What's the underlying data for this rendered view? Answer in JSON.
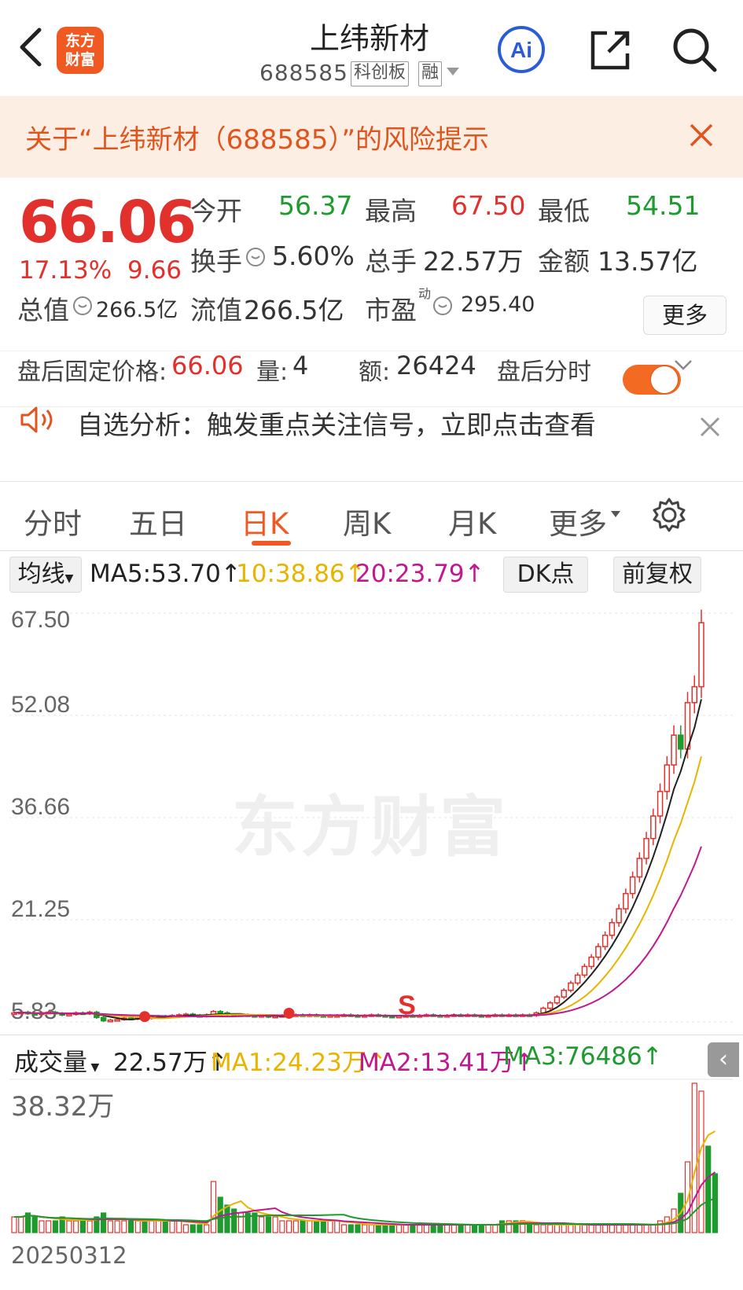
{
  "header": {
    "logo_line1": "东方",
    "logo_line2": "财富",
    "stock_name": "上纬新材",
    "stock_code": "688585",
    "board_tag": "科创板",
    "margin_tag": "融",
    "ai_label": "Ai"
  },
  "risk_banner": {
    "text": "关于“上纬新材（688585）”的风险提示"
  },
  "quote": {
    "price": "66.06",
    "change_pct": "17.13%",
    "change": "9.66",
    "fields": [
      {
        "label": "今开",
        "value": "56.37",
        "color": "#1e9b2f"
      },
      {
        "label": "最高",
        "value": "67.50",
        "color": "#e2312d"
      },
      {
        "label": "最低",
        "value": "54.51",
        "color": "#1e9b2f"
      },
      {
        "label": "换手",
        "value": "5.60%",
        "color": "#333333"
      },
      {
        "label": "总手",
        "value": "22.57万",
        "color": "#333333"
      },
      {
        "label": "金额",
        "value": "13.57亿",
        "color": "#333333"
      },
      {
        "label": "总值",
        "value": "266.5亿",
        "color": "#333333"
      },
      {
        "label": "流值",
        "value": "266.5亿",
        "color": "#333333"
      },
      {
        "label": "市盈",
        "value": "295.40",
        "color": "#333333"
      }
    ],
    "pe_superscript": "动",
    "more_button": "更多"
  },
  "after_hours": {
    "price_label": "盘后固定价格:",
    "price": "66.06",
    "volume_label": "量:",
    "volume": "4",
    "amount_label": "额:",
    "amount": "26424",
    "toggle_label": "盘后分时",
    "toggle_on": true
  },
  "analysis": {
    "text": "自选分析：触发重点关注信号，立即点击查看"
  },
  "tabs": [
    {
      "label": "分时",
      "active": false
    },
    {
      "label": "五日",
      "active": false
    },
    {
      "label": "日K",
      "active": true
    },
    {
      "label": "周K",
      "active": false
    },
    {
      "label": "月K",
      "active": false
    },
    {
      "label": "更多",
      "active": false
    }
  ],
  "ma_bar": {
    "selector": "均线",
    "ma5": "MA5:53.70↑",
    "ma10": "10:38.86↑",
    "ma20": "20:23.79↑",
    "dk_button": "DK点",
    "adjust_button": "前复权",
    "colors": {
      "ma5": "#222222",
      "ma10": "#e8b400",
      "ma20": "#c2188f"
    }
  },
  "watermark": "东方财富",
  "volume_bar": {
    "selector": "成交量",
    "vol": "22.57万↑",
    "ma1": "MA1:24.23万↑",
    "ma2": "MA2:13.41万↑",
    "ma3": "MA3:76486↑",
    "max_label": "38.32万",
    "collapse": "‹"
  },
  "date_label": "20250312",
  "chart_data": {
    "type": "candlestick",
    "y_ticks": [
      "67.50",
      "52.08",
      "36.66",
      "21.25",
      "5.83"
    ],
    "ylim": [
      5.83,
      67.5
    ],
    "signal_label": "S",
    "closes": [
      7.2,
      7.3,
      7.1,
      7.0,
      7.2,
      7.3,
      7.1,
      6.9,
      7.0,
      7.2,
      7.1,
      7.3,
      6.5,
      6.0,
      6.1,
      6.2,
      6.4,
      6.3,
      6.5,
      6.4,
      6.6,
      6.7,
      6.6,
      6.8,
      6.9,
      7.0,
      6.8,
      6.7,
      6.9,
      7.4,
      7.2,
      6.9,
      6.8,
      6.9,
      6.8,
      6.7,
      6.8,
      6.6,
      6.7,
      6.8,
      6.9,
      6.9,
      6.8,
      6.9,
      6.8,
      6.7,
      6.8,
      6.8,
      6.9,
      6.8,
      6.7,
      6.8,
      6.9,
      6.8,
      6.7,
      6.6,
      6.7,
      6.8,
      6.7,
      6.8,
      6.9,
      6.8,
      6.7,
      6.8,
      6.9,
      6.8,
      6.9,
      6.8,
      6.7,
      6.8,
      6.9,
      6.8,
      6.9,
      6.8,
      6.9,
      6.8,
      7.2,
      7.9,
      8.7,
      9.6,
      10.6,
      11.7,
      12.9,
      14.2,
      15.6,
      17.2,
      18.9,
      20.8,
      22.9,
      25.2,
      27.7,
      30.5,
      33.5,
      36.9,
      40.6,
      44.6,
      49.1,
      47.0,
      54.0,
      56.4,
      66.06
    ],
    "volumes": [
      4,
      4,
      5,
      4,
      3,
      3,
      3,
      4,
      3,
      3,
      3,
      3,
      4,
      5,
      3,
      3,
      3,
      3,
      3,
      3,
      3,
      3,
      3,
      3,
      3,
      2,
      2,
      2,
      2,
      13,
      9,
      7,
      6,
      5,
      5,
      5,
      4,
      4,
      4,
      3,
      3,
      3,
      3,
      3,
      3,
      3,
      3,
      3,
      2,
      2,
      2,
      2,
      2,
      2,
      2,
      2,
      2,
      2,
      2,
      2,
      2,
      2,
      2,
      2,
      2,
      2,
      2,
      2,
      2,
      2,
      2,
      3,
      3,
      3,
      3,
      2,
      2,
      2,
      2,
      2,
      2,
      2,
      2,
      2,
      2,
      2,
      2,
      2,
      2,
      2,
      2,
      2,
      2,
      2,
      3,
      4,
      6,
      10,
      18,
      38,
      36,
      22,
      15
    ]
  }
}
